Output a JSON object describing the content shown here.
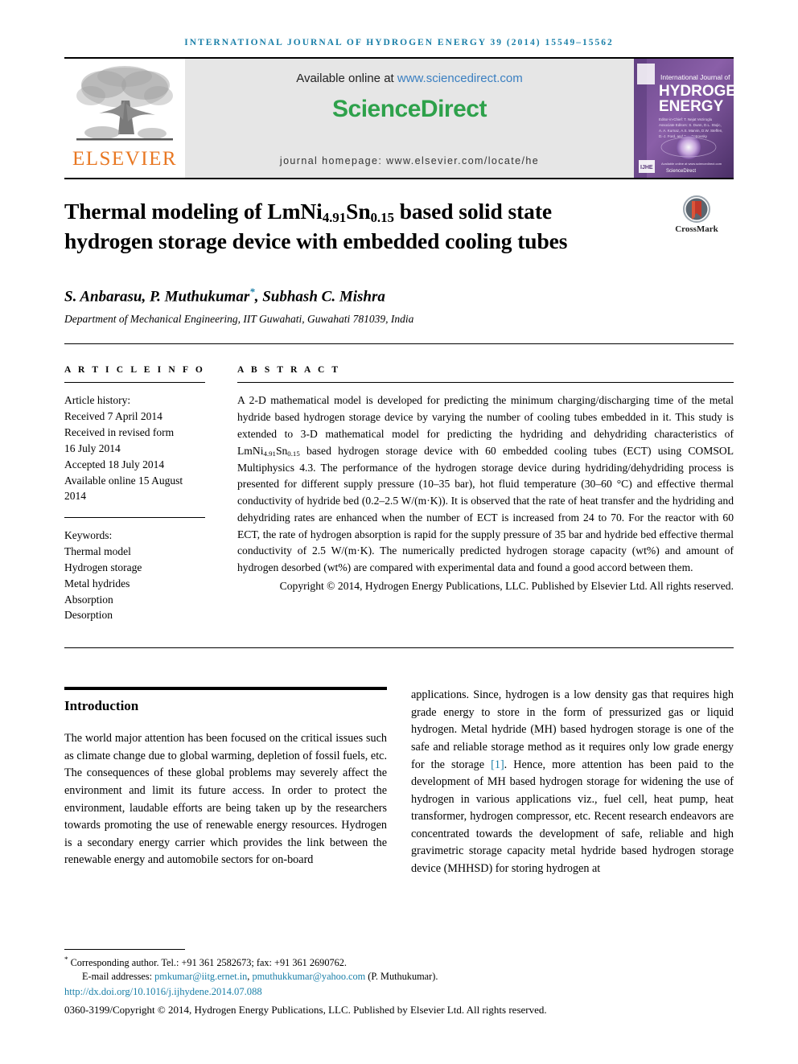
{
  "running_head": "INTERNATIONAL JOURNAL OF HYDROGEN ENERGY 39 (2014) 15549–15562",
  "masthead": {
    "publisher_name": "ELSEVIER",
    "available_prefix": "Available online at ",
    "available_url": "www.sciencedirect.com",
    "sciencedirect_logo": "ScienceDirect",
    "journal_homepage": "journal homepage: www.elsevier.com/locate/he",
    "cover": {
      "line1": "International Journal of",
      "line2": "HYDROGEN",
      "line3": "ENERGY",
      "editor_label": "Editor-in-Chief:",
      "editor_name": "T. Nejat Veziroglu",
      "assoc_label": "Associate Editors:",
      "assoc_names": "S. Dunn, D.L. Stojic, A. A. Kurnaz, A.S. Marvin, D.W. Steffen, D.-J. Ford, and F.A. Petrovsky",
      "footer_tag": "IJHE",
      "footer_note": "Available online at www.sciencedirect.com",
      "footer_sd": "ScienceDirect"
    }
  },
  "article": {
    "title_part1": "Thermal modeling of LmNi",
    "title_sub1": "4.91",
    "title_part2": "Sn",
    "title_sub2": "0.15",
    "title_part3": " based solid state hydrogen storage device with embedded cooling tubes",
    "crossmark_label": "CrossMark",
    "authors": "S. Anbarasu, P. Muthukumar",
    "author_star": "*",
    "authors_tail": ", Subhash C. Mishra",
    "affiliation": "Department of Mechanical Engineering, IIT Guwahati, Guwahati 781039, India"
  },
  "article_info": {
    "heading": "A R T I C L E  I N F O",
    "history_label": "Article history:",
    "history": [
      "Received 7 April 2014",
      "Received in revised form",
      "16 July 2014",
      "Accepted 18 July 2014",
      "Available online 15 August 2014"
    ],
    "keywords_label": "Keywords:",
    "keywords": [
      "Thermal model",
      "Hydrogen storage",
      "Metal hydrides",
      "Absorption",
      "Desorption"
    ]
  },
  "abstract": {
    "heading": "A B S T R A C T",
    "p1_a": "A 2-D mathematical model is developed for predicting the minimum charging/discharging time of the metal hydride based hydrogen storage device by varying the number of cooling tubes embedded in it. This study is extended to 3-D mathematical model for predicting the hydriding and dehydriding characteristics of LmNi",
    "p1_sub1": "4.91",
    "p1_b": "Sn",
    "p1_sub2": "0.15",
    "p1_c": " based hydrogen storage device with 60 embedded cooling tubes (ECT) using COMSOL Multiphysics 4.3. The performance of the hydrogen storage device during hydriding/dehydriding process is presented for different supply pressure (10–35 bar), hot fluid temperature (30–60 °C) and effective thermal conductivity of hydride bed (0.2–2.5 W/(m·K)). It is observed that the rate of heat transfer and the hydriding and dehydriding rates are enhanced when the number of ECT is increased from 24 to 70. For the reactor with 60 ECT, the rate of hydrogen absorption is rapid for the supply pressure of 35 bar and hydride bed effective thermal conductivity of 2.5 W/(m·K). The numerically predicted hydrogen storage capacity (wt%) and amount of hydrogen desorbed (wt%) are compared with experimental data and found a good accord between them.",
    "copyright": "Copyright © 2014, Hydrogen Energy Publications, LLC. Published by Elsevier Ltd. All rights reserved."
  },
  "body": {
    "intro_heading": "Introduction",
    "left_paragraph": "The world major attention has been focused on the critical issues such as climate change due to global warming, depletion of fossil fuels, etc. The consequences of these global problems may severely affect the environment and limit its future access. In order to protect the environment, laudable efforts are being taken up by the researchers towards promoting the use of renewable energy resources. Hydrogen is a secondary energy carrier which provides the link between the renewable energy and automobile sectors for on-board",
    "right_part1": "applications. Since, hydrogen is a low density gas that requires high grade energy to store in the form of pressurized gas or liquid hydrogen. Metal hydride (MH) based hydrogen storage is one of the safe and reliable storage method as it requires only low grade energy for the storage ",
    "right_ref": "[1]",
    "right_part2": ". Hence, more attention has been paid to the development of MH based hydrogen storage for widening the use of hydrogen in various applications viz., fuel cell, heat pump, heat transformer, hydrogen compressor, etc. Recent research endeavors are concentrated towards the development of safe, reliable and high gravimetric storage capacity metal hydride based hydrogen storage device (MHHSD) for storing hydrogen at"
  },
  "footer": {
    "corresponding": "Corresponding author. Tel.: +91 361 2582673; fax: +91 361 2690762.",
    "email_label": "E-mail addresses: ",
    "email1": "pmkumar@iitg.ernet.in",
    "email_sep": ", ",
    "email2": "pmuthukkumar@yahoo.com",
    "email_tail": " (P. Muthukumar).",
    "doi": "http://dx.doi.org/10.1016/j.ijhydene.2014.07.088",
    "issn": "0360-3199/Copyright © 2014, Hydrogen Energy Publications, LLC. Published by Elsevier Ltd. All rights reserved."
  },
  "colors": {
    "accent_blue": "#1a7fa8",
    "link_blue": "#3a7fc1",
    "sciencedirect_green": "#2EA14B",
    "elsevier_orange": "#E87722",
    "banner_grey": "#e6e6e6"
  }
}
